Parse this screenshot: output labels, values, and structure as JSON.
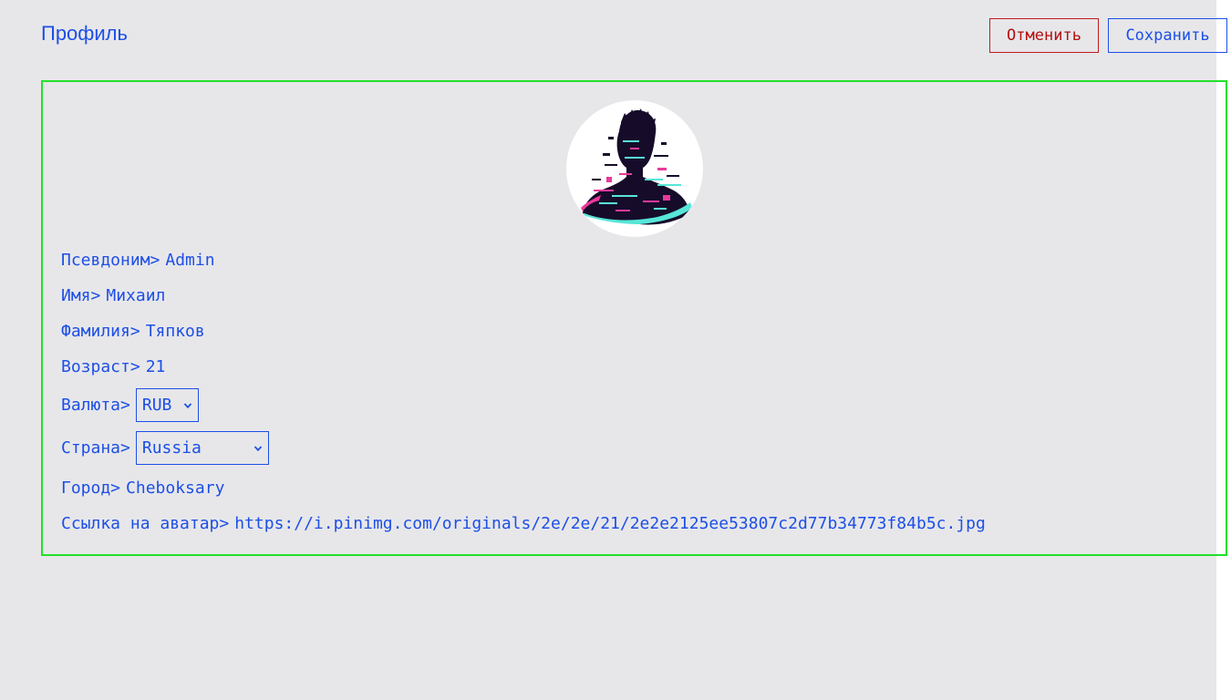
{
  "header": {
    "title": "Профиль",
    "cancel_label": "Отменить",
    "save_label": "Сохранить"
  },
  "colors": {
    "accent": "#1d4fe6",
    "danger": "#b40f0f",
    "card_border": "#22e02a",
    "background": "#e7e7ea"
  },
  "avatar": {
    "icon": "user-avatar-glitch-silhouette"
  },
  "fields": {
    "nickname": {
      "label": "Псевдоним>",
      "value": "Admin"
    },
    "first_name": {
      "label": "Имя>",
      "value": "Михаил"
    },
    "last_name": {
      "label": "Фамилия>",
      "value": "Тяпков"
    },
    "age": {
      "label": "Возраст>",
      "value": "21"
    },
    "currency": {
      "label": "Валюта>",
      "selected": "RUB"
    },
    "country": {
      "label": "Страна>",
      "selected": "Russia"
    },
    "city": {
      "label": "Город>",
      "value": "Cheboksary"
    },
    "avatar_link": {
      "label": "Ссылка на аватар>",
      "value": "https://i.pinimg.com/originals/2e/2e/21/2e2e2125ee53807c2d77b34773f84b5c.jpg"
    }
  }
}
